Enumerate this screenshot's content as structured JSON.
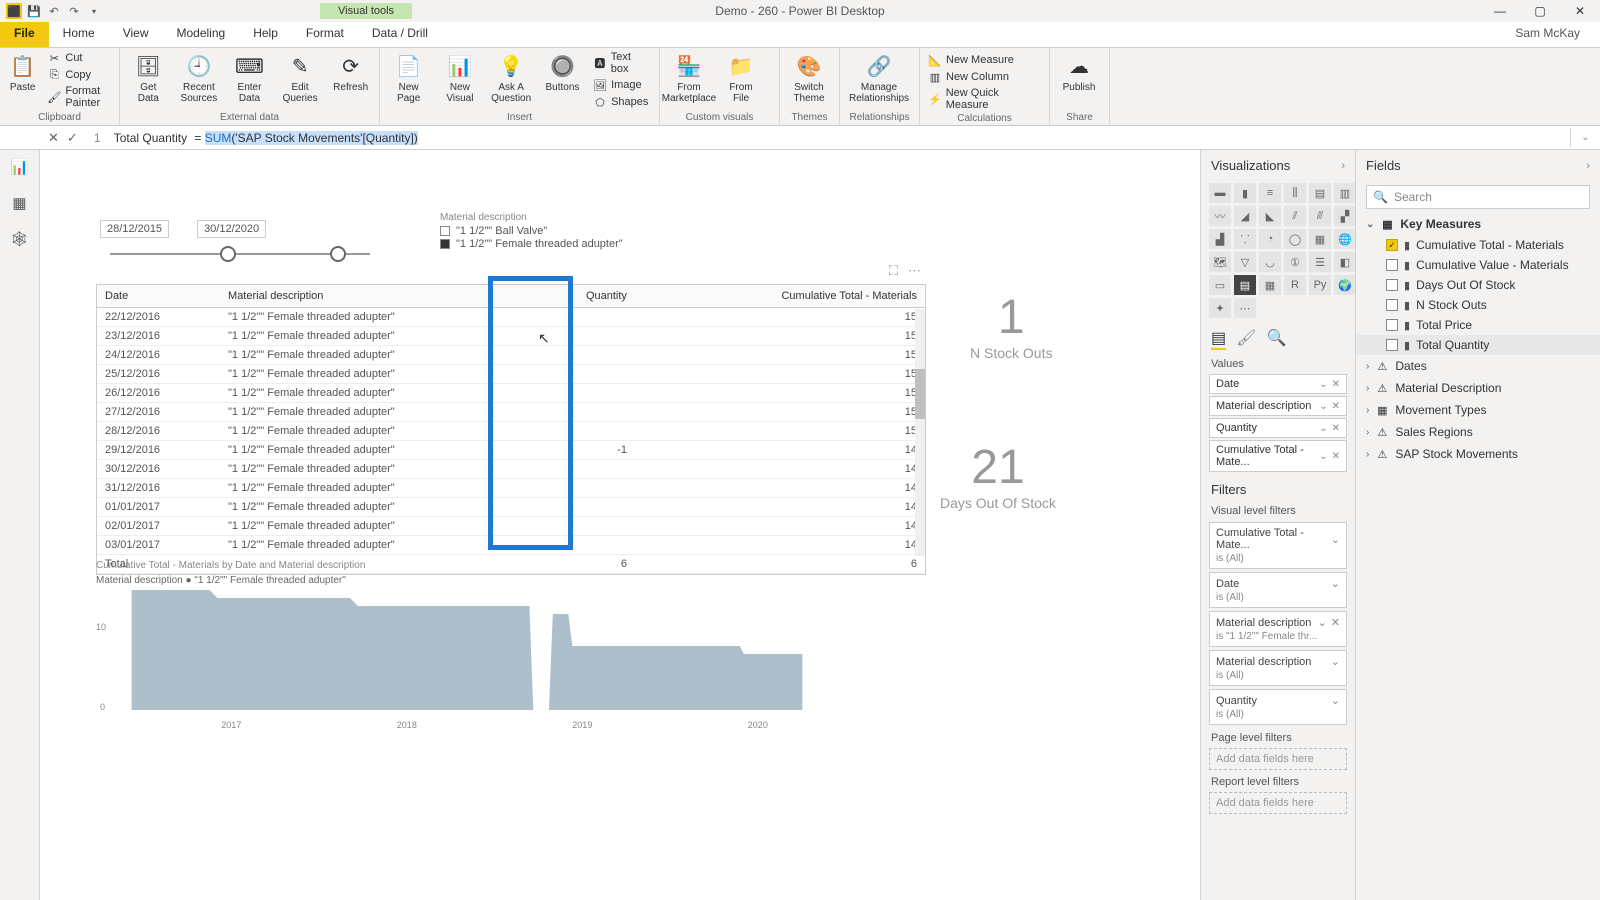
{
  "titlebar": {
    "visual_tools": "Visual tools",
    "title": "Demo - 260 - Power BI Desktop"
  },
  "tabs": {
    "file": "File",
    "items": [
      "Home",
      "View",
      "Modeling",
      "Help",
      "Format",
      "Data / Drill"
    ],
    "username": "Sam McKay"
  },
  "ribbon": {
    "clipboard": {
      "paste": "Paste",
      "cut": "Cut",
      "copy": "Copy",
      "format_painter": "Format Painter",
      "label": "Clipboard"
    },
    "external": {
      "get_data": "Get\nData",
      "recent": "Recent\nSources",
      "enter": "Enter\nData",
      "edit": "Edit\nQueries",
      "refresh": "Refresh",
      "label": "External data"
    },
    "insert": {
      "new_page": "New\nPage",
      "new_visual": "New\nVisual",
      "ask": "Ask A\nQuestion",
      "buttons": "Buttons",
      "textbox": "Text box",
      "image": "Image",
      "shapes": "Shapes",
      "label": "Insert"
    },
    "custom": {
      "market": "From\nMarketplace",
      "file": "From\nFile",
      "label": "Custom visuals"
    },
    "themes": {
      "switch": "Switch\nTheme",
      "label": "Themes"
    },
    "rel": {
      "manage": "Manage\nRelationships",
      "label": "Relationships"
    },
    "calc": {
      "new_measure": "New Measure",
      "new_column": "New Column",
      "new_quick": "New Quick Measure",
      "label": "Calculations"
    },
    "share": {
      "publish": "Publish",
      "label": "Share"
    }
  },
  "formula": {
    "line": "1",
    "name": "Total Quantity",
    "eq": "=",
    "func": "SUM",
    "arg": "('SAP Stock Movements'[Quantity])"
  },
  "slicer": {
    "start": "28/12/2015",
    "end": "30/12/2020"
  },
  "legend": {
    "title": "Material description",
    "items": [
      "\"1 1/2\"\" Ball Valve\"",
      "\"1 1/2\"\" Female threaded adupter\""
    ]
  },
  "table": {
    "headers": [
      "Date",
      "Material description",
      "Quantity",
      "Cumulative Total - Materials"
    ],
    "rows": [
      [
        "22/12/2016",
        "\"1 1/2\"\" Female threaded adupter\"",
        "",
        "15"
      ],
      [
        "23/12/2016",
        "\"1 1/2\"\" Female threaded adupter\"",
        "",
        "15"
      ],
      [
        "24/12/2016",
        "\"1 1/2\"\" Female threaded adupter\"",
        "",
        "15"
      ],
      [
        "25/12/2016",
        "\"1 1/2\"\" Female threaded adupter\"",
        "",
        "15"
      ],
      [
        "26/12/2016",
        "\"1 1/2\"\" Female threaded adupter\"",
        "",
        "15"
      ],
      [
        "27/12/2016",
        "\"1 1/2\"\" Female threaded adupter\"",
        "",
        "15"
      ],
      [
        "28/12/2016",
        "\"1 1/2\"\" Female threaded adupter\"",
        "",
        "15"
      ],
      [
        "29/12/2016",
        "\"1 1/2\"\" Female threaded adupter\"",
        "-1",
        "14"
      ],
      [
        "30/12/2016",
        "\"1 1/2\"\" Female threaded adupter\"",
        "",
        "14"
      ],
      [
        "31/12/2016",
        "\"1 1/2\"\" Female threaded adupter\"",
        "",
        "14"
      ],
      [
        "01/01/2017",
        "\"1 1/2\"\" Female threaded adupter\"",
        "",
        "14"
      ],
      [
        "02/01/2017",
        "\"1 1/2\"\" Female threaded adupter\"",
        "",
        "14"
      ],
      [
        "03/01/2017",
        "\"1 1/2\"\" Female threaded adupter\"",
        "",
        "14"
      ]
    ],
    "total_label": "Total",
    "total_qty": "6",
    "total_cum": "6"
  },
  "cards": {
    "c1_value": "1",
    "c1_label": "N Stock Outs",
    "c2_value": "21",
    "c2_label": "Days Out Of Stock"
  },
  "chart_data": {
    "type": "area",
    "title": "Cumulative Total - Materials by Date and Material description",
    "legend": "Material description  ● \"1 1/2\"\" Female threaded adupter\"",
    "ylabel": "",
    "xlabel": "",
    "ylim": [
      0,
      15
    ],
    "yticks": [
      0,
      10
    ],
    "xticks": [
      "2017",
      "2018",
      "2019",
      "2020"
    ],
    "series": [
      {
        "name": "\"1 1/2\"\" Female threaded adupter\"",
        "points": [
          {
            "x": 0.02,
            "y": 15
          },
          {
            "x": 0.12,
            "y": 15
          },
          {
            "x": 0.13,
            "y": 14
          },
          {
            "x": 0.3,
            "y": 14
          },
          {
            "x": 0.31,
            "y": 13
          },
          {
            "x": 0.53,
            "y": 13
          },
          {
            "x": 0.535,
            "y": 0
          },
          {
            "x": 0.555,
            "y": 0
          },
          {
            "x": 0.56,
            "y": 12
          },
          {
            "x": 0.58,
            "y": 12
          },
          {
            "x": 0.585,
            "y": 8
          },
          {
            "x": 0.8,
            "y": 8
          },
          {
            "x": 0.805,
            "y": 7
          },
          {
            "x": 0.88,
            "y": 7
          }
        ]
      }
    ]
  },
  "viz_pane": {
    "header": "Visualizations",
    "values": "Values",
    "wells": [
      {
        "label": "Date"
      },
      {
        "label": "Material description"
      },
      {
        "label": "Quantity"
      },
      {
        "label": "Cumulative Total - Mate..."
      }
    ],
    "filters_header": "Filters",
    "visual_filters": "Visual level filters",
    "filters": [
      {
        "label": "Cumulative Total - Mate...",
        "sub": "is (All)",
        "close": false
      },
      {
        "label": "Date",
        "sub": "is (All)",
        "close": false
      },
      {
        "label": "Material description",
        "sub": "is \"1 1/2\"\" Female thr...",
        "close": true
      },
      {
        "label": "Material description",
        "sub": "is (All)",
        "close": false
      },
      {
        "label": "Quantity",
        "sub": "is (All)",
        "close": false
      }
    ],
    "page_filters": "Page level filters",
    "report_filters": "Report level filters",
    "add_placeholder": "Add data fields here"
  },
  "fields_pane": {
    "header": "Fields",
    "search": "Search",
    "tables": [
      {
        "name": "Key Measures",
        "expanded": true,
        "highlighted": true,
        "icon": "measure",
        "items": [
          {
            "name": "Cumulative Total - Materials",
            "checked": true
          },
          {
            "name": "Cumulative Value - Materials",
            "checked": false
          },
          {
            "name": "Days Out Of Stock",
            "checked": false
          },
          {
            "name": "N Stock Outs",
            "checked": false
          },
          {
            "name": "Total Price",
            "checked": false
          },
          {
            "name": "Total Quantity",
            "checked": false,
            "selected": true
          }
        ]
      },
      {
        "name": "Dates",
        "expanded": false,
        "warn": true
      },
      {
        "name": "Material Description",
        "expanded": false,
        "warn": true
      },
      {
        "name": "Movement Types",
        "expanded": false
      },
      {
        "name": "Sales Regions",
        "expanded": false,
        "warn": true
      },
      {
        "name": "SAP Stock Movements",
        "expanded": false,
        "warn": true
      }
    ]
  }
}
